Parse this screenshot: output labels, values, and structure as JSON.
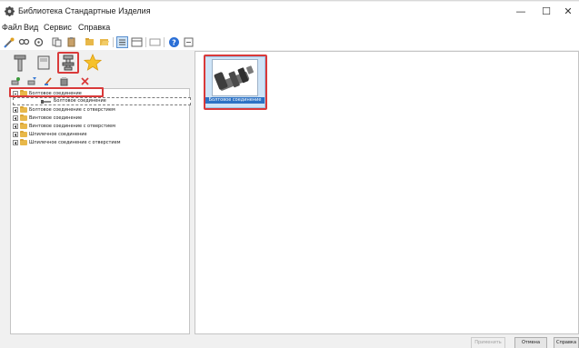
{
  "window": {
    "title": "Библиотека Стандартные Изделия",
    "controls": {
      "minimize": "—",
      "maximize": "☐",
      "close": "✕"
    }
  },
  "menu": [
    "Файл",
    "Вид",
    "Сервис",
    "Справка"
  ],
  "toolbar": {
    "icons": [
      "settings-icon",
      "search-icon",
      "refresh-icon",
      "copy-icon",
      "paste-icon",
      "folder-icon",
      "open-folder-icon",
      "view-list-icon",
      "view-details-icon",
      "window-icon",
      "help-icon",
      "about-icon"
    ]
  },
  "categories": {
    "icons": [
      "bolt-category-icon",
      "book-category-icon",
      "connections-category-icon",
      "favorites-icon"
    ],
    "selected": "connections-category-icon"
  },
  "actions": {
    "icons": [
      "add-icon",
      "edit-icon",
      "rename-icon",
      "properties-icon",
      "delete-icon"
    ]
  },
  "tree": {
    "rows": [
      {
        "label": "Болтовое соединение",
        "expanded": true
      },
      {
        "label": "Болтовое соединение с отверстием",
        "expanded": false
      },
      {
        "label": "Винтовое соединение",
        "expanded": false
      },
      {
        "label": "Винтовое соединение с отверстием",
        "expanded": false
      },
      {
        "label": "Шпилечное соединение",
        "expanded": false
      },
      {
        "label": "Шпилечное соединение с отверстием",
        "expanded": false
      }
    ],
    "child": {
      "label": "Болтовое соединение"
    }
  },
  "preview": {
    "items": [
      {
        "label": "Болтовое соединение"
      }
    ]
  },
  "buttons": {
    "apply": "Применить",
    "cancel": "Отмена",
    "help": "Справка"
  },
  "colors": {
    "highlight": "#d93a3a",
    "selection": "#2d72c4",
    "folder": "#e8b84a"
  }
}
